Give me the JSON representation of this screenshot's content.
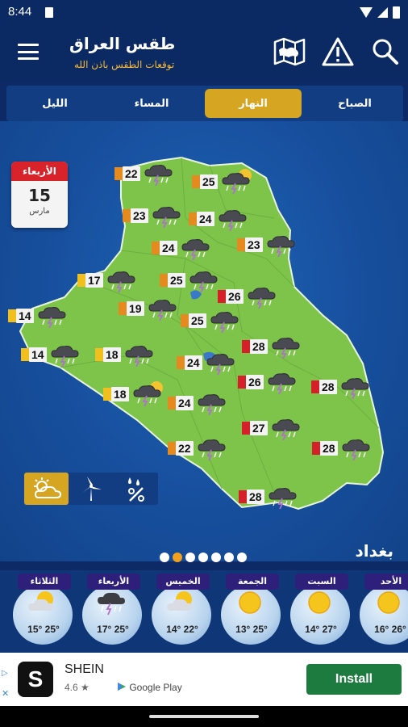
{
  "status": {
    "time": "8:44"
  },
  "header": {
    "title": "طقس العراق",
    "subtitle": "توقعات الطقس باذن الله"
  },
  "tabs": [
    {
      "label": "الليل",
      "active": false
    },
    {
      "label": "المساء",
      "active": false
    },
    {
      "label": "النهار",
      "active": true
    },
    {
      "label": "الصباح",
      "active": false
    }
  ],
  "calendar": {
    "weekday": "الأربعاء",
    "day": "15",
    "month": "مارس"
  },
  "map_markers": [
    {
      "temp": "22",
      "level": "orange",
      "icon": "storm"
    },
    {
      "temp": "25",
      "level": "orange",
      "icon": "storm-sun"
    },
    {
      "temp": "23",
      "level": "orange",
      "icon": "storm"
    },
    {
      "temp": "24",
      "level": "orange",
      "icon": "storm"
    },
    {
      "temp": "24",
      "level": "orange",
      "icon": "storm"
    },
    {
      "temp": "23",
      "level": "orange",
      "icon": "storm"
    },
    {
      "temp": "17",
      "level": "yellow",
      "icon": "storm"
    },
    {
      "temp": "25",
      "level": "orange",
      "icon": "storm"
    },
    {
      "temp": "26",
      "level": "red",
      "icon": "storm"
    },
    {
      "temp": "14",
      "level": "yellow",
      "icon": "storm"
    },
    {
      "temp": "19",
      "level": "orange",
      "icon": "storm"
    },
    {
      "temp": "25",
      "level": "orange",
      "icon": "storm"
    },
    {
      "temp": "14",
      "level": "yellow",
      "icon": "storm"
    },
    {
      "temp": "18",
      "level": "yellow",
      "icon": "storm"
    },
    {
      "temp": "24",
      "level": "orange",
      "icon": "storm"
    },
    {
      "temp": "28",
      "level": "red",
      "icon": "storm"
    },
    {
      "temp": "18",
      "level": "yellow",
      "icon": "storm-sun"
    },
    {
      "temp": "26",
      "level": "red",
      "icon": "storm"
    },
    {
      "temp": "28",
      "level": "red",
      "icon": "storm"
    },
    {
      "temp": "24",
      "level": "orange",
      "icon": "storm"
    },
    {
      "temp": "27",
      "level": "red",
      "icon": "storm"
    },
    {
      "temp": "22",
      "level": "orange",
      "icon": "storm"
    },
    {
      "temp": "28",
      "level": "red",
      "icon": "storm"
    },
    {
      "temp": "28",
      "level": "red",
      "icon": "storm"
    }
  ],
  "level_colors": {
    "yellow": "#f2c01e",
    "orange": "#e58a1f",
    "red": "#d5202a"
  },
  "modes": [
    {
      "icon": "partly-cloudy-icon",
      "active": true
    },
    {
      "icon": "wind-turbine-icon",
      "active": false
    },
    {
      "icon": "humidity-icon",
      "active": false
    }
  ],
  "pager": {
    "count": 7,
    "active_index": 1
  },
  "city": "بغداد",
  "forecast": [
    {
      "day": "الثلاثاء",
      "low": "15°",
      "high": "25°",
      "icon": "partly-cloudy"
    },
    {
      "day": "الأربعاء",
      "low": "17°",
      "high": "25°",
      "icon": "storm"
    },
    {
      "day": "الخميس",
      "low": "14°",
      "high": "22°",
      "icon": "partly-cloudy"
    },
    {
      "day": "الجمعة",
      "low": "13°",
      "high": "25°",
      "icon": "sun"
    },
    {
      "day": "السبت",
      "low": "14°",
      "high": "27°",
      "icon": "sun"
    },
    {
      "day": "الأحد",
      "low": "16°",
      "high": "26°",
      "icon": "sun"
    }
  ],
  "ad": {
    "name": "SHEIN",
    "rating": "4.6 ★",
    "store": "Google Play",
    "install": "Install",
    "logo_letter": "S"
  }
}
